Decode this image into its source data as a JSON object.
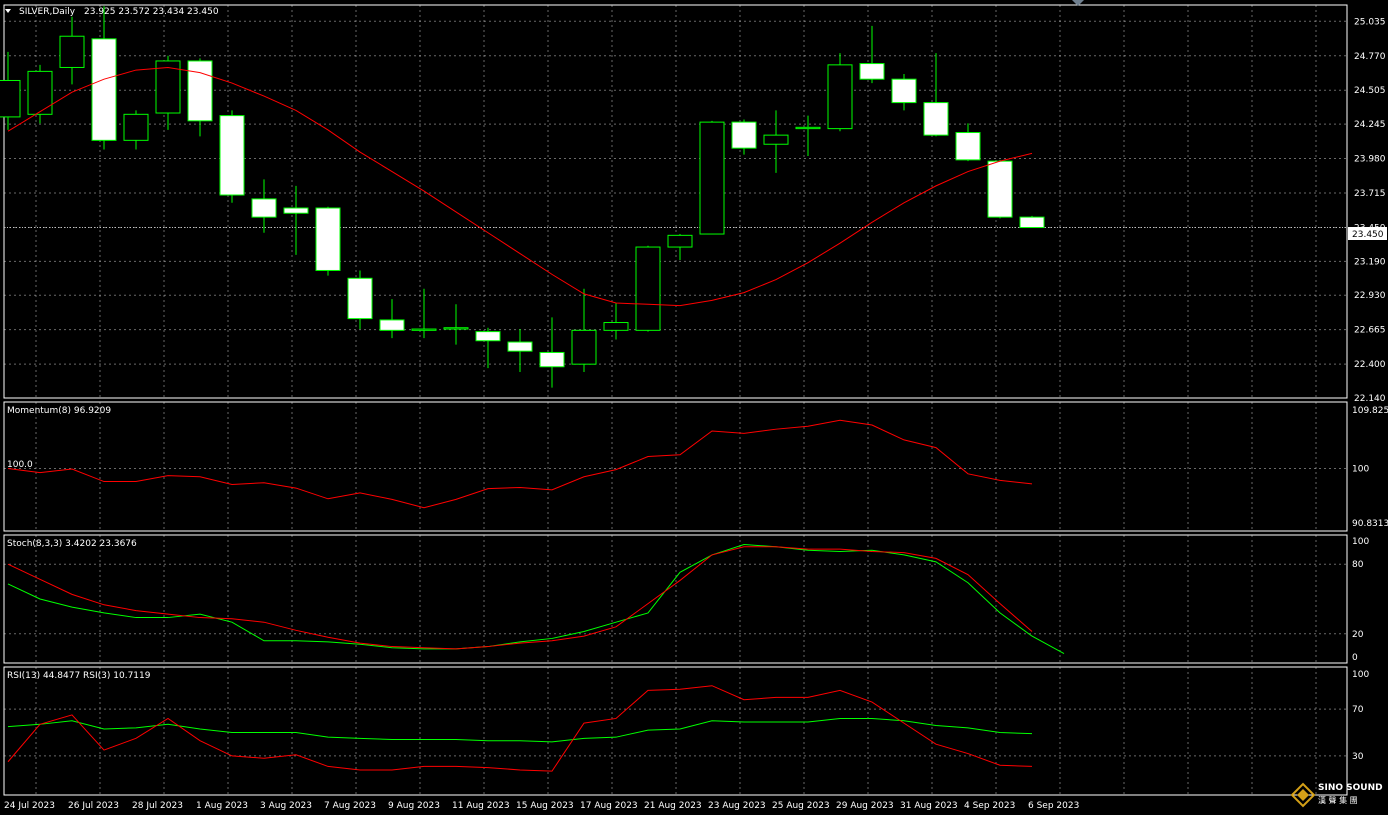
{
  "header": {
    "symbol": "SILVER,Daily",
    "ohlc": "23.925 23.572 23.434 23.450"
  },
  "colors": {
    "background": "#000000",
    "grid": "#c0c0c0",
    "bull_candle_fill": "#000000",
    "bear_candle_fill": "#ffffff",
    "candle_border": "#00ff00",
    "wick": "#00ff00",
    "ma_line": "#ff0000",
    "stoch_main": "#00ff00",
    "stoch_signal": "#ff0000",
    "rsi13": "#00ff00",
    "rsi3": "#ff0000",
    "momentum": "#ff0000",
    "frame": "#ffffff",
    "text": "#ffffff"
  },
  "price_panel": {
    "price_ticks": [
      "25.035",
      "24.770",
      "24.505",
      "24.245",
      "23.980",
      "23.715",
      "23.450",
      "23.190",
      "22.930",
      "22.665",
      "22.400",
      "22.140"
    ],
    "current_price_label": "23.450"
  },
  "momentum_panel": {
    "label": "Momentum(8) 96.9209",
    "ticks": [
      "109.825",
      "100",
      "90.8313"
    ],
    "level_label": "100.0"
  },
  "stoch_panel": {
    "label": "Stoch(8,3,3) 3.4202 23.3676",
    "ticks": [
      "100",
      "80",
      "20",
      "0"
    ]
  },
  "rsi_panel": {
    "label": "RSI(13) 44.8477  RSI(3) 10.7119",
    "ticks": [
      "100",
      "70",
      "30"
    ]
  },
  "x_axis": {
    "labels": [
      "24 Jul 2023",
      "26 Jul 2023",
      "28 Jul 2023",
      "1 Aug 2023",
      "3 Aug 2023",
      "7 Aug 2023",
      "9 Aug 2023",
      "11 Aug 2023",
      "15 Aug 2023",
      "17 Aug 2023",
      "21 Aug 2023",
      "23 Aug 2023",
      "25 Aug 2023",
      "29 Aug 2023",
      "31 Aug 2023",
      "4 Sep 2023",
      "6 Sep 2023"
    ]
  },
  "logo": {
    "text": "SINO SOUND",
    "subtext": "漢 聲 集 團"
  },
  "chart_data": [
    {
      "type": "candlestick",
      "title": "SILVER,Daily",
      "ylim": [
        22.14,
        25.16
      ],
      "candles": [
        {
          "o": 24.3,
          "h": 24.8,
          "l": 24.2,
          "c": 24.58
        },
        {
          "o": 24.32,
          "h": 24.7,
          "l": 24.25,
          "c": 24.65
        },
        {
          "o": 24.68,
          "h": 25.07,
          "l": 24.55,
          "c": 24.92
        },
        {
          "o": 24.9,
          "h": 25.15,
          "l": 24.05,
          "c": 24.12
        },
        {
          "o": 24.12,
          "h": 24.35,
          "l": 24.05,
          "c": 24.32
        },
        {
          "o": 24.33,
          "h": 24.77,
          "l": 24.2,
          "c": 24.73
        },
        {
          "o": 24.73,
          "h": 24.75,
          "l": 24.15,
          "c": 24.27
        },
        {
          "o": 24.31,
          "h": 24.35,
          "l": 23.64,
          "c": 23.7
        },
        {
          "o": 23.67,
          "h": 23.82,
          "l": 23.41,
          "c": 23.53
        },
        {
          "o": 23.6,
          "h": 23.77,
          "l": 23.24,
          "c": 23.56
        },
        {
          "o": 23.6,
          "h": 23.61,
          "l": 23.08,
          "c": 23.12
        },
        {
          "o": 23.06,
          "h": 23.12,
          "l": 22.67,
          "c": 22.75
        },
        {
          "o": 22.74,
          "h": 22.9,
          "l": 22.6,
          "c": 22.66
        },
        {
          "o": 22.66,
          "h": 22.98,
          "l": 22.6,
          "c": 22.67
        },
        {
          "o": 22.67,
          "h": 22.86,
          "l": 22.55,
          "c": 22.68
        },
        {
          "o": 22.65,
          "h": 22.68,
          "l": 22.37,
          "c": 22.58
        },
        {
          "o": 22.57,
          "h": 22.67,
          "l": 22.34,
          "c": 22.5
        },
        {
          "o": 22.49,
          "h": 22.76,
          "l": 22.22,
          "c": 22.38
        },
        {
          "o": 22.4,
          "h": 22.98,
          "l": 22.34,
          "c": 22.66
        },
        {
          "o": 22.66,
          "h": 22.87,
          "l": 22.59,
          "c": 22.72
        },
        {
          "o": 22.66,
          "h": 23.31,
          "l": 22.65,
          "c": 23.3
        },
        {
          "o": 23.3,
          "h": 23.4,
          "l": 23.2,
          "c": 23.39
        },
        {
          "o": 23.4,
          "h": 24.27,
          "l": 23.4,
          "c": 24.26
        },
        {
          "o": 24.26,
          "h": 24.28,
          "l": 24.01,
          "c": 24.06
        },
        {
          "o": 24.09,
          "h": 24.35,
          "l": 23.87,
          "c": 24.16
        },
        {
          "o": 24.21,
          "h": 24.31,
          "l": 24.0,
          "c": 24.22
        },
        {
          "o": 24.21,
          "h": 24.79,
          "l": 24.19,
          "c": 24.7
        },
        {
          "o": 24.71,
          "h": 25.0,
          "l": 24.56,
          "c": 24.59
        },
        {
          "o": 24.59,
          "h": 24.63,
          "l": 24.35,
          "c": 24.41
        },
        {
          "o": 24.41,
          "h": 24.79,
          "l": 24.15,
          "c": 24.16
        },
        {
          "o": 24.18,
          "h": 24.25,
          "l": 23.96,
          "c": 23.97
        },
        {
          "o": 23.96,
          "h": 23.97,
          "l": 23.52,
          "c": 23.53
        },
        {
          "o": 23.53,
          "h": 23.54,
          "l": 23.45,
          "c": 23.45
        }
      ],
      "ma": [
        24.19,
        24.34,
        24.49,
        24.59,
        24.66,
        24.68,
        24.64,
        24.56,
        24.46,
        24.35,
        24.2,
        24.03,
        23.88,
        23.73,
        23.57,
        23.41,
        23.25,
        23.09,
        22.94,
        22.87,
        22.86,
        22.85,
        22.89,
        22.95,
        23.05,
        23.18,
        23.33,
        23.49,
        23.64,
        23.77,
        23.88,
        23.96,
        24.02
      ]
    },
    {
      "type": "line",
      "title": "Momentum(8)",
      "ylim": [
        90.8313,
        109.825
      ],
      "series": [
        {
          "name": "Momentum(8)",
          "values": [
            100.0,
            99.3,
            99.9,
            97.8,
            97.8,
            98.8,
            98.6,
            97.3,
            97.6,
            96.7,
            94.9,
            95.9,
            94.8,
            93.4,
            94.8,
            96.6,
            96.8,
            96.4,
            98.6,
            99.8,
            102.0,
            102.3,
            106.3,
            105.9,
            106.6,
            107.1,
            108.1,
            107.3,
            104.8,
            103.5,
            99.1,
            98.0,
            97.4
          ]
        }
      ]
    },
    {
      "type": "line",
      "title": "Stoch(8,3,3)",
      "ylim": [
        0,
        100
      ],
      "series": [
        {
          "name": "Stoch(8,3,3) main",
          "values": [
            63,
            50,
            43,
            38,
            34,
            34,
            37,
            30,
            14,
            14,
            13,
            11,
            8,
            7,
            7,
            9,
            13,
            16,
            22,
            30,
            38,
            73,
            88,
            97,
            95,
            92,
            91,
            92,
            88,
            82,
            64,
            38,
            18,
            3
          ]
        },
        {
          "name": "Stoch(8,3,3) signal",
          "values": [
            80,
            67,
            54,
            45,
            40,
            37,
            34,
            33,
            30,
            23,
            17,
            12,
            9,
            8,
            7,
            9,
            12,
            14,
            18,
            26,
            46,
            66,
            88,
            95,
            95,
            93,
            93,
            91,
            90,
            85,
            71,
            46,
            22
          ]
        }
      ]
    },
    {
      "type": "line",
      "title": "RSI",
      "ylim": [
        0,
        100
      ],
      "series": [
        {
          "name": "RSI(13)",
          "values": [
            55,
            57,
            60,
            53,
            54,
            57,
            53,
            50,
            50,
            50,
            46,
            45,
            44,
            44,
            44,
            43,
            43,
            42,
            45,
            46,
            52,
            53,
            60,
            59,
            59,
            59,
            62,
            62,
            60,
            56,
            54,
            50,
            49
          ]
        },
        {
          "name": "RSI(3)",
          "values": [
            25,
            57,
            65,
            35,
            45,
            62,
            43,
            30,
            28,
            31,
            21,
            18,
            18,
            21,
            21,
            20,
            18,
            17,
            58,
            62,
            86,
            87,
            90,
            78,
            80,
            80,
            86,
            76,
            58,
            40,
            32,
            22,
            21
          ]
        }
      ]
    }
  ]
}
